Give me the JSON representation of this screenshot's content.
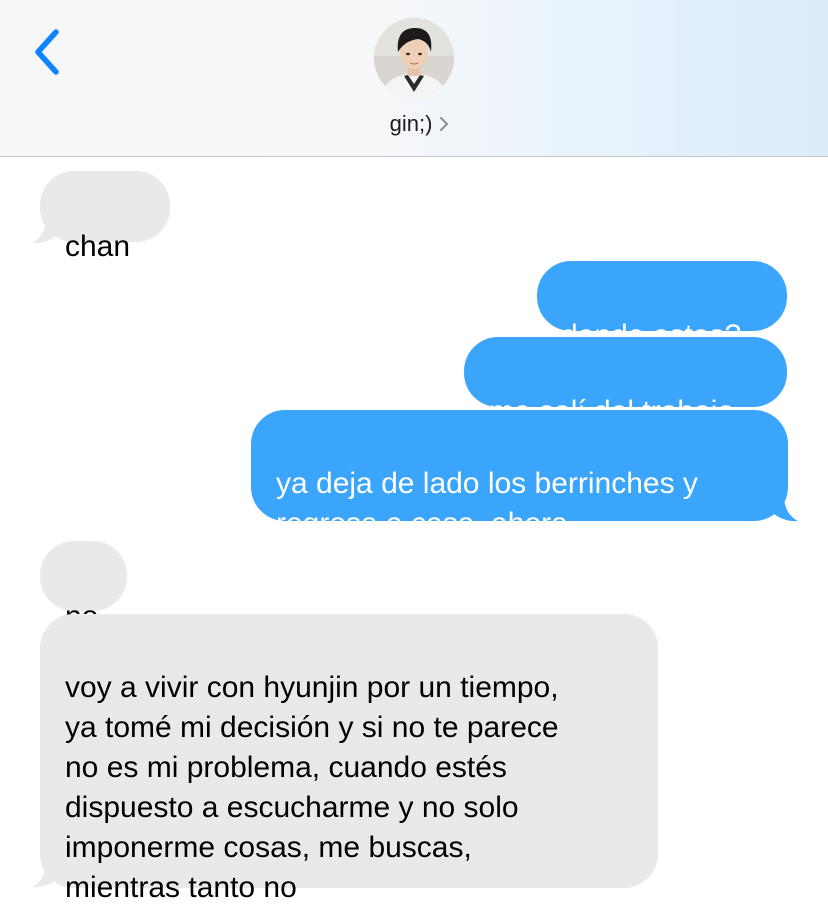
{
  "header": {
    "contact_name": "gin;)",
    "icons": {
      "back": "chevron-left-icon",
      "details": "chevron-right-icon"
    },
    "accent_color": "#0a84ff"
  },
  "messages": [
    {
      "direction": "received",
      "text": "chan"
    },
    {
      "direction": "sent",
      "text": "donde estas?"
    },
    {
      "direction": "sent",
      "text": "me salí del trabajo"
    },
    {
      "direction": "sent",
      "text": "ya deja de lado los berrinches y\nregresa a casa, ahora"
    },
    {
      "direction": "received",
      "text": "no"
    },
    {
      "direction": "received",
      "text": "voy a vivir con hyunjin por un tiempo,\nya tomé mi decisión y si no te parece\nno es mi problema, cuando estés\ndispuesto a escucharme y no solo\nimponerme cosas, me buscas,\nmientras tanto no"
    }
  ],
  "colors": {
    "sent_bubble": "#3aa5fb",
    "received_bubble": "#e9e9eb"
  }
}
